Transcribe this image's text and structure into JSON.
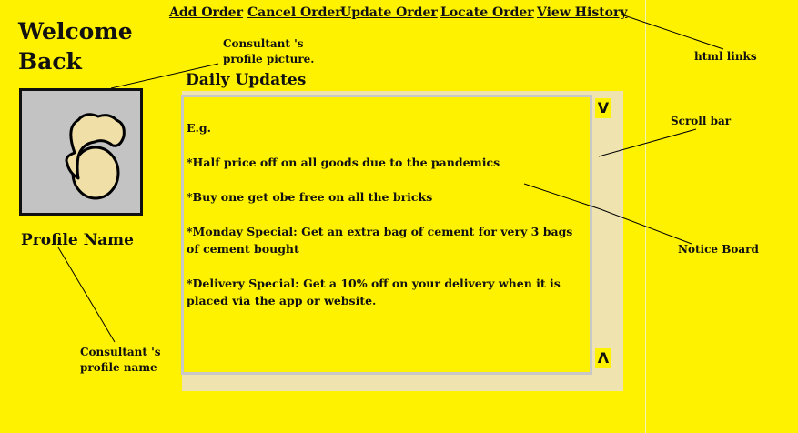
{
  "nav": {
    "add_order": "Add Order",
    "cancel_order": "Cancel Order",
    "update_order": "Update Order",
    "locate_order": "Locate Order",
    "view_history": "View History"
  },
  "welcome": {
    "line1": "Welcome",
    "line2": "Back"
  },
  "profile": {
    "name": "Profile Name"
  },
  "notice_board": {
    "title": "Daily Updates",
    "items": [
      "E.g.",
      "*Half price off on all goods due to the pandemics",
      "*Buy one get obe free on all the bricks",
      "*Monday Special: Get an extra bag of cement for very 3 bags of cement bought",
      "*Delivery Special: Get a 10% off on your delivery when it is placed via the app or website."
    ]
  },
  "scrollbar": {
    "down_glyph": "V",
    "up_glyph": "Λ"
  },
  "annotations": {
    "profile_picture_line1": "Consultant 's",
    "profile_picture_line2": "profile picture.",
    "profile_name_line1": "Consultant 's",
    "profile_name_line2": "profile name",
    "html_links": "html links",
    "scroll_bar": "Scroll bar",
    "notice_board": "Notice Board"
  },
  "icons": {
    "avatar": "avatar-sketch-icon"
  },
  "colors": {
    "background": "#fff200",
    "panel": "#efe4b0",
    "avatar_bg": "#c3c3c3"
  }
}
